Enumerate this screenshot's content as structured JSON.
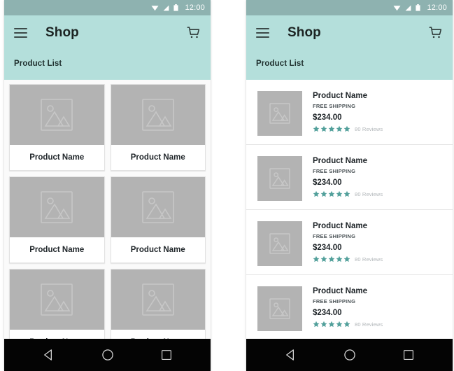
{
  "theme": {
    "appbar_color": "#b4dfdb",
    "statusbar_color": "#8eb2b0",
    "star_color": "#52a09b",
    "placeholder_color": "#b3b3b3",
    "navbar_color": "#040404"
  },
  "statusbar": {
    "time": "12:00",
    "icons": [
      "wifi-icon",
      "signal-icon",
      "battery-icon"
    ]
  },
  "appbar": {
    "menu_icon": "hamburger-menu-icon",
    "title": "Shop",
    "cart_icon": "shopping-cart-icon",
    "subtitle": "Product List"
  },
  "navbar": {
    "back_label": "back-icon",
    "home_label": "home-icon",
    "recents_label": "recents-icon"
  },
  "grid_screen": {
    "cards": [
      {
        "name": "Product Name",
        "image": "image-placeholder-icon"
      },
      {
        "name": "Product Name",
        "image": "image-placeholder-icon"
      },
      {
        "name": "Product Name",
        "image": "image-placeholder-icon"
      },
      {
        "name": "Product Name",
        "image": "image-placeholder-icon"
      },
      {
        "name": "Product Name",
        "image": "image-placeholder-icon"
      },
      {
        "name": "Product Name",
        "image": "image-placeholder-icon"
      }
    ]
  },
  "list_screen": {
    "items": [
      {
        "name": "Product Name",
        "shipping": "FREE SHIPPING",
        "price": "$234.00",
        "stars": 5,
        "reviews": "80 Reviews",
        "image": "image-placeholder-icon"
      },
      {
        "name": "Product Name",
        "shipping": "FREE SHIPPING",
        "price": "$234.00",
        "stars": 5,
        "reviews": "80 Reviews",
        "image": "image-placeholder-icon"
      },
      {
        "name": "Product Name",
        "shipping": "FREE SHIPPING",
        "price": "$234.00",
        "stars": 5,
        "reviews": "80 Reviews",
        "image": "image-placeholder-icon"
      },
      {
        "name": "Product Name",
        "shipping": "FREE SHIPPING",
        "price": "$234.00",
        "stars": 5,
        "reviews": "80 Reviews",
        "image": "image-placeholder-icon"
      }
    ]
  }
}
